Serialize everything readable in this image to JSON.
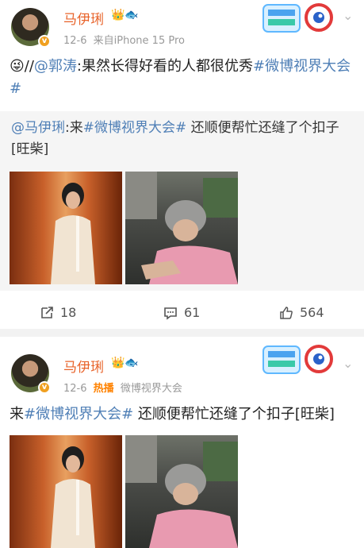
{
  "posts": [
    {
      "username": "马伊琍",
      "date": "12-6",
      "source": "来自iPhone 15 Pro",
      "text_prefix": "//",
      "mention": "@郭涛",
      "text_main": ":果然长得好看的人都很优秀",
      "hashtag": "#微博视界大会#",
      "repost": {
        "mention": "@马伊琍",
        "text_a": ":来",
        "hashtag": "#微博视界大会#",
        "text_b": " 还顺便帮忙还缝了个扣子[旺柴]"
      },
      "actions": {
        "reposts": "18",
        "comments": "61",
        "likes": "564"
      }
    },
    {
      "username": "马伊琍",
      "date": "12-6",
      "hot_label": "热播",
      "source": "微博视界大会",
      "text_a": "来",
      "hashtag": "#微博视界大会#",
      "text_b": " 还顺便帮忙还缝了个扣子[旺柴]"
    }
  ],
  "icons": {
    "verified": "verified-badge-icon",
    "crown": "member-crown-icon",
    "emoji": "tongue-out-emoji-icon",
    "repost": "repost-icon",
    "comment": "comment-icon",
    "like": "thumbs-up-icon",
    "chevron": "chevron-down-icon",
    "sticker": "national-day-sticker-icon"
  },
  "colors": {
    "username": "#e8632a",
    "link": "#4f7fb6",
    "hot": "#ff8200",
    "meta": "#999999"
  }
}
